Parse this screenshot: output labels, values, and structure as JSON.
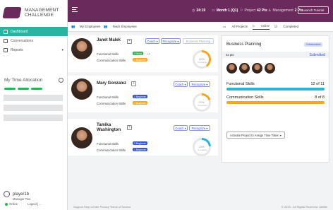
{
  "app": {
    "title_line1": "MANAGEMENT",
    "title_line2": "CHALLENGE"
  },
  "sidebar": {
    "items": [
      {
        "label": "Dashboard",
        "icon": "dashboard-icon"
      },
      {
        "label": "Conversations",
        "icon": "chat-icon"
      },
      {
        "label": "Reports",
        "icon": "reports-icon"
      }
    ],
    "allocation_title": "My Time Allocation"
  },
  "user": {
    "name": "player1b",
    "role": "Manager Two",
    "status": "Online",
    "logout": "Logout [→"
  },
  "topbar": {
    "time": "24:19",
    "month": "Month 1 (Q1)",
    "project_label": "Project",
    "project_pts": "42 Pts",
    "mgmt_label": "Management",
    "mgmt_pts": "2 Pts",
    "launch": "Launch Tutorial"
  },
  "employees_tabs": {
    "mine": "My Employees",
    "team": "Team Employees"
  },
  "employees": [
    {
      "name": "Janet Malek",
      "skill1": "Functional Skills",
      "badge1": "3 Ninja",
      "badge1_color": "#2bb34f",
      "extra": "+1",
      "skill2": "Communication Skills",
      "badge2": "1 Beginner",
      "badge2_color": "#f5a623",
      "pct": "40%",
      "pct_value": 40,
      "gauge_color": "#f5a623",
      "sub": "Competent",
      "coach": "Coach ▾",
      "recognize": "Recognize ▾",
      "planning": "Business Planning"
    },
    {
      "name": "Mary Gonzalez",
      "skill1": "Functional Skills",
      "badge1": "1 Beginner",
      "badge1_color": "#3a55c4",
      "skill2": "Communication Skills",
      "badge2": "1 Beginner",
      "badge2_color": "#f5a623",
      "pct": "20%",
      "pct_value": 20,
      "gauge_color": "#f5a623",
      "sub": "Competent",
      "coach": "Coach ▾",
      "recognize": "Recognize ▾"
    },
    {
      "name_line1": "Tamika",
      "name_line2": "Washington",
      "skill1": "Functional Skills",
      "badge1": "2 Beginner",
      "badge1_color": "#3a55c4",
      "skill2": "Communication Skills",
      "badge2": "1 Beginner",
      "badge2_color": "#3a55c4",
      "pct": "23%",
      "pct_value": 23,
      "gauge_color": "#2bb3d0",
      "sub": "Competent",
      "coach": "Coach ▾",
      "recognize": "Recognize ▾"
    }
  ],
  "projects_tabs": {
    "all": "All Projects",
    "active": "Active",
    "completed": "Completed"
  },
  "project": {
    "title": "Business Planning",
    "tag": "Collaborative",
    "pts": "42 pts",
    "status": "Submitted",
    "functional_label": "Functional Skills",
    "functional_value": "12 of 11",
    "communication_label": "Communication Skills",
    "communication_value": "8 of 8",
    "functional_color": "#2bb3d0",
    "communication_color": "#f5a623",
    "activate": "Activate Project to Assign Time Token ▾"
  },
  "footer": {
    "links": "Support  Help Center  Privacy  Terms of Service",
    "copyright": "© 2019 - All Rights Reserved. Abilitie"
  }
}
